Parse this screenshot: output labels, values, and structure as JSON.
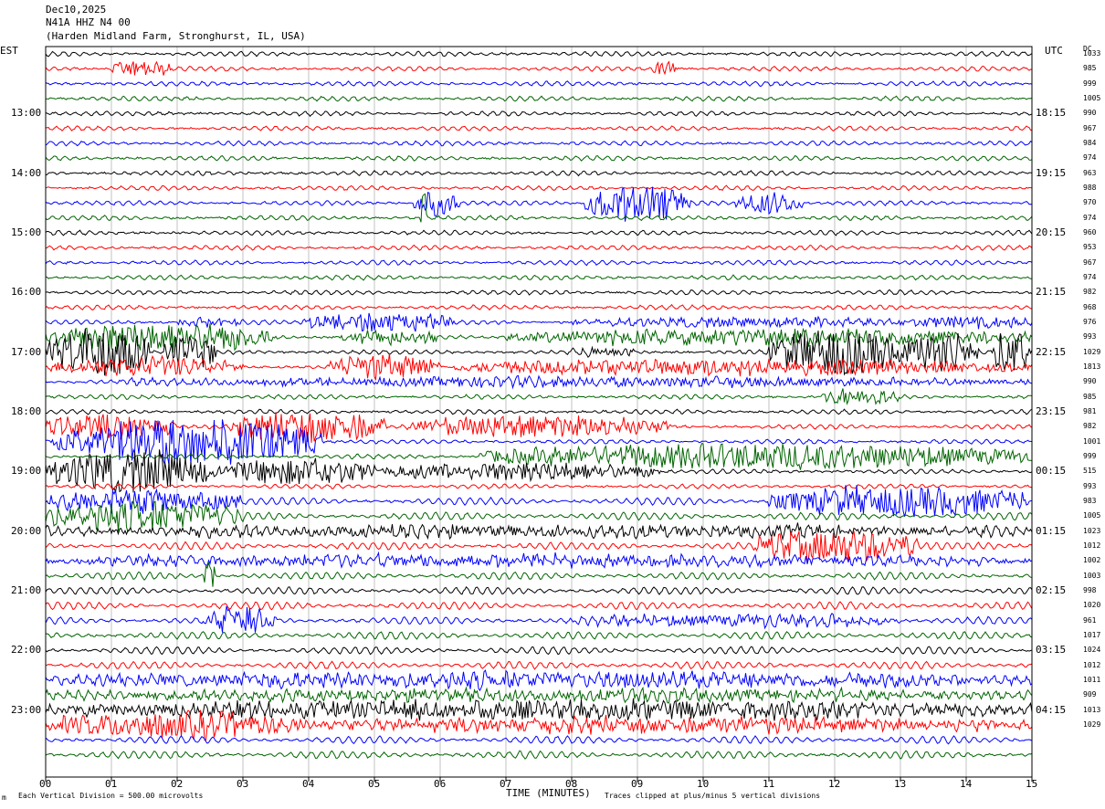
{
  "header": {
    "date": "Dec10,2025",
    "station": "N41A HHZ N4 00",
    "location": "(Harden Midland Farm, Stronghurst, IL, USA)"
  },
  "left_tz_label": "EST",
  "right_tz_label": "UTC",
  "dc_label": "DC",
  "footer": {
    "scale_note": "Each Vertical Division = 500.00 microvolts",
    "clip_note": "Traces clipped at plus/minus 5 vertical divisions",
    "mark": "m"
  },
  "colors": {
    "trace_cycle": [
      "#000000",
      "#ff0000",
      "#0000ff",
      "#006400"
    ],
    "grid": "#9a9a9a"
  },
  "chart_data": {
    "type": "line",
    "title": "",
    "xlabel": "TIME (MINUTES)",
    "ylabel": "",
    "xlim": [
      0,
      15
    ],
    "x_ticks": [
      "00",
      "01",
      "02",
      "03",
      "04",
      "05",
      "06",
      "07",
      "08",
      "09",
      "10",
      "11",
      "12",
      "13",
      "14",
      "15"
    ],
    "est_time_labels": [
      "13:00",
      "14:00",
      "15:00",
      "16:00",
      "17:00",
      "18:00",
      "19:00",
      "20:00",
      "21:00",
      "22:00",
      "23:00"
    ],
    "utc_time_labels": [
      "18:15",
      "19:15",
      "20:15",
      "21:15",
      "22:15",
      "23:15",
      "00:15",
      "01:15",
      "02:15",
      "03:15",
      "04:15"
    ],
    "trace_count": 48,
    "dc_offsets": [
      1033,
      985,
      999,
      1005,
      990,
      967,
      984,
      974,
      963,
      988,
      970,
      974,
      960,
      953,
      967,
      974,
      982,
      968,
      976,
      993,
      1029,
      1813,
      990,
      985,
      981,
      982,
      1001,
      999,
      515,
      993,
      983,
      1005,
      1023,
      1012,
      1002,
      1003,
      998,
      1020,
      961,
      1017,
      1024,
      1012,
      1011,
      909,
      1013,
      1029
    ],
    "grid": true,
    "clip_divisions": 5,
    "vertical_division_microvolts": 500.0
  }
}
